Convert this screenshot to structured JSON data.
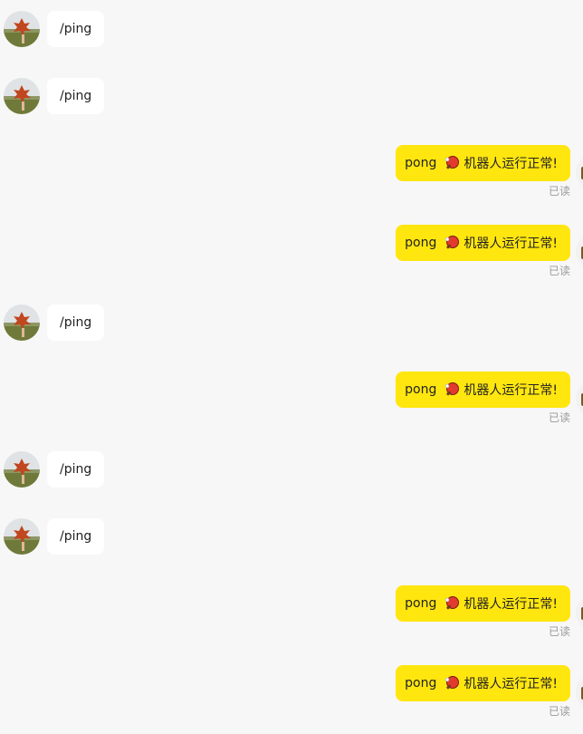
{
  "colors": {
    "background": "#f7f7f7",
    "incoming_bubble": "#ffffff",
    "outgoing_bubble": "#ffe60f",
    "read_text": "#9b9b9b"
  },
  "messages": [
    {
      "direction": "in",
      "text": "/ping"
    },
    {
      "direction": "in",
      "text": "/ping"
    },
    {
      "direction": "out",
      "word": "pong",
      "emoji": "ping-pong-icon",
      "text": "机器人运行正常!",
      "status": "已读"
    },
    {
      "direction": "out",
      "word": "pong",
      "emoji": "ping-pong-icon",
      "text": "机器人运行正常!",
      "status": "已读"
    },
    {
      "direction": "in",
      "text": "/ping"
    },
    {
      "direction": "out",
      "word": "pong",
      "emoji": "ping-pong-icon",
      "text": "机器人运行正常!",
      "status": "已读"
    },
    {
      "direction": "in",
      "text": "/ping"
    },
    {
      "direction": "in",
      "text": "/ping"
    },
    {
      "direction": "out",
      "word": "pong",
      "emoji": "ping-pong-icon",
      "text": "机器人运行正常!",
      "status": "已读"
    },
    {
      "direction": "out",
      "word": "pong",
      "emoji": "ping-pong-icon",
      "text": "机器人运行正常!",
      "status": "已读"
    }
  ]
}
